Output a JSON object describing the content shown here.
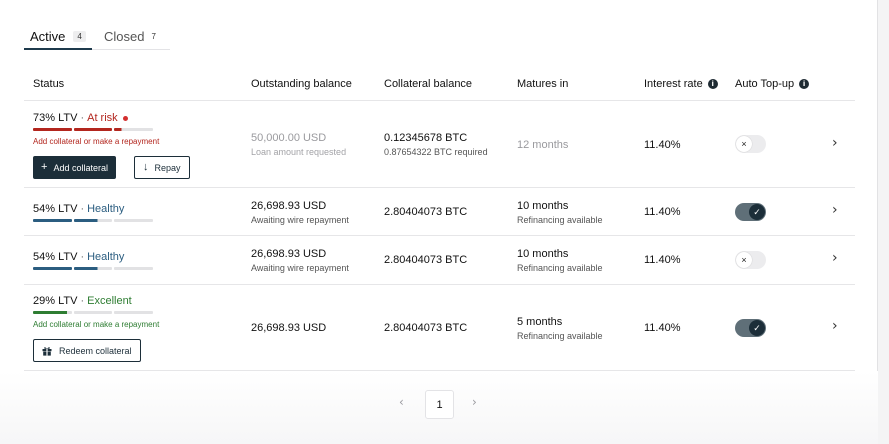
{
  "tabs": [
    {
      "label": "Active",
      "count": "4"
    },
    {
      "label": "Closed",
      "count": "7"
    }
  ],
  "columns": {
    "status": "Status",
    "outstanding": "Outstanding balance",
    "collateral": "Collateral balance",
    "matures": "Matures in",
    "interest": "Interest rate",
    "auto_topup": "Auto Top-up"
  },
  "icons": {
    "info": "i",
    "plus": "+",
    "arrow_down": "↓",
    "gift": "gift",
    "chevron_right": "›",
    "chevron_left": "‹",
    "check": "✓",
    "x": "×"
  },
  "colors": {
    "at_risk": "#b3261e",
    "healthy": "#2b5d80",
    "excellent": "#2e7d32",
    "primary": "#1c2e39"
  },
  "rows": [
    {
      "ltv": "73% LTV",
      "status": "At risk",
      "ltv_fraction": 0.73,
      "hint": "Add collateral or make a repayment",
      "buttons": {
        "add_collateral": "Add collateral",
        "repay": "Repay"
      },
      "outstanding": "50,000.00 USD",
      "outstanding_sub": "Loan amount requested",
      "collateral": "0.12345678 BTC",
      "collateral_sub": "0.87654322 BTC required",
      "matures": "12 months",
      "matures_sub": "",
      "interest": "11.40%",
      "auto_topup": false
    },
    {
      "ltv": "54% LTV",
      "status": "Healthy",
      "ltv_fraction": 0.54,
      "outstanding": "26,698.93 USD",
      "outstanding_sub": "Awaiting wire repayment",
      "collateral": "2.80404073 BTC",
      "matures": "10 months",
      "matures_sub": "Refinancing available",
      "interest": "11.40%",
      "auto_topup": true
    },
    {
      "ltv": "54% LTV",
      "status": "Healthy",
      "ltv_fraction": 0.54,
      "outstanding": "26,698.93 USD",
      "outstanding_sub": "Awaiting wire repayment",
      "collateral": "2.80404073 BTC",
      "matures": "10 months",
      "matures_sub": "Refinancing available",
      "interest": "11.40%",
      "auto_topup": false
    },
    {
      "ltv": "29% LTV",
      "status": "Excellent",
      "ltv_fraction": 0.29,
      "hint": "Add collateral or make a repayment",
      "buttons": {
        "redeem": "Redeem collateral"
      },
      "outstanding": "26,698.93 USD",
      "collateral": "2.80404073 BTC",
      "matures": "5 months",
      "matures_sub": "Refinancing available",
      "interest": "11.40%",
      "auto_topup": true
    }
  ],
  "pagination": {
    "current": "1"
  }
}
